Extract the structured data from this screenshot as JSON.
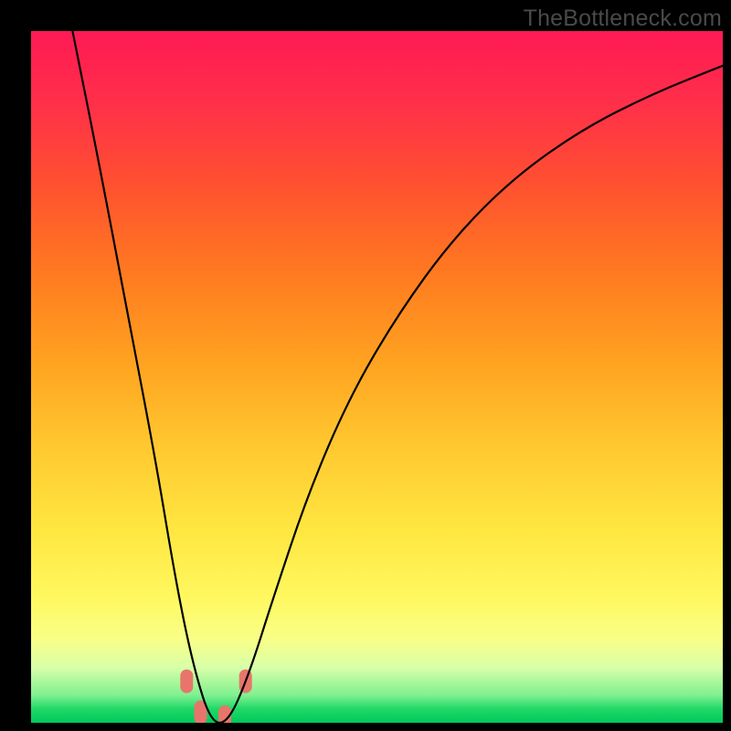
{
  "watermark": "TheBottleneck.com",
  "chart_data": {
    "type": "line",
    "title": "",
    "xlabel": "",
    "ylabel": "",
    "xlim": [
      0,
      100
    ],
    "ylim": [
      0,
      100
    ],
    "note": "Axes are unlabeled in the source image; x/y values are estimated pixel-normalized positions (0–100). The curve is a V-shaped bottleneck profile that drops from top-left, bottoms out near x≈26 (y≈0), then rises toward the upper-right with decreasing slope. Four salmon-colored marker blobs sit on the curve near the trough.",
    "series": [
      {
        "name": "bottleneck-curve",
        "x": [
          6,
          10,
          14,
          18,
          21,
          23.5,
          26,
          28.5,
          31.5,
          35,
          40,
          46,
          53,
          61,
          70,
          80,
          90,
          100
        ],
        "y": [
          100,
          80,
          59,
          38,
          20,
          8,
          0,
          0,
          7,
          18,
          33,
          47,
          59,
          70,
          79,
          86,
          91,
          95
        ],
        "stroke": "#000000",
        "stroke_width": 2.2
      }
    ],
    "markers": [
      {
        "name": "marker-1",
        "x": 22.5,
        "y": 6,
        "color": "#e8756b"
      },
      {
        "name": "marker-2",
        "x": 24.5,
        "y": 1.5,
        "color": "#e8756b"
      },
      {
        "name": "marker-3",
        "x": 28.0,
        "y": 0.8,
        "color": "#e8756b"
      },
      {
        "name": "marker-4",
        "x": 31.0,
        "y": 6,
        "color": "#e8756b"
      }
    ],
    "background_gradient": {
      "top": "#ff1a55",
      "mid": "#ffd040",
      "bottom": "#00c85a"
    }
  }
}
